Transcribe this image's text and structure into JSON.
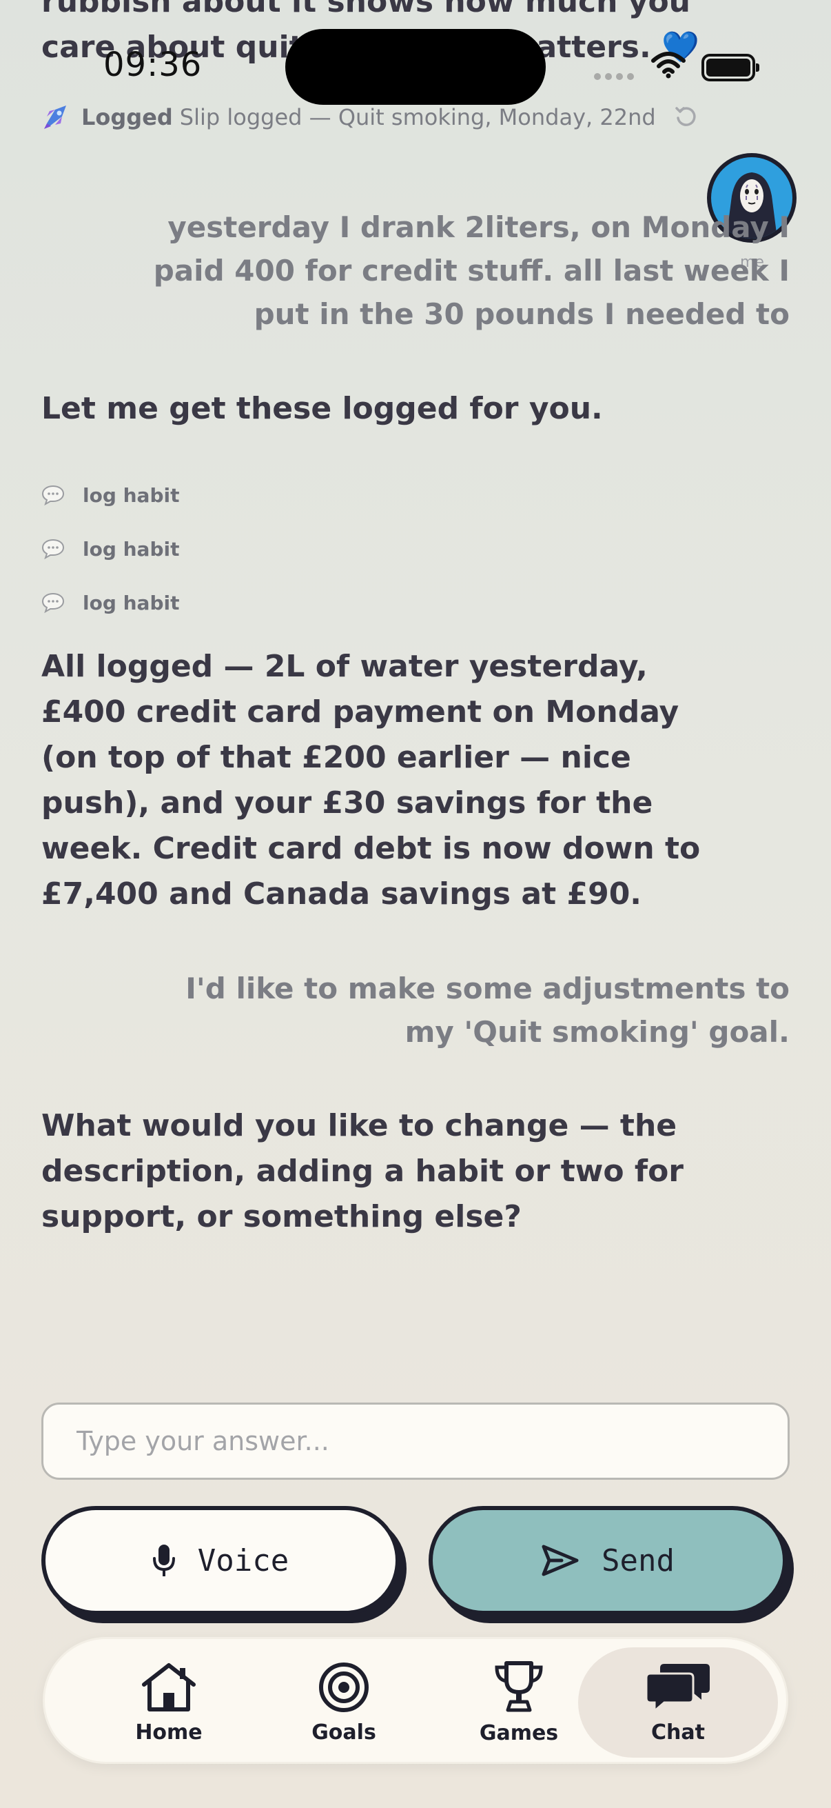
{
  "chat": {
    "scrolled_text": "rubbish about it shows how much you care about quitting — that matters. 💙",
    "log_line": {
      "logged_label": "Logged",
      "text": "Slip logged — Quit smoking, Monday, 22nd"
    },
    "avatar_label": "me",
    "messages": [
      {
        "role": "user",
        "text": "yesterday I drank 2liters, on Monday I paid 400 for credit stuff. all last week I put in the 30 pounds I needed to"
      },
      {
        "role": "assistant",
        "text": "Let me get these logged for you."
      },
      {
        "role": "assistant",
        "text": "All logged — 2L of water yesterday, £400 credit card payment on Monday (on top of that £200 earlier — nice push), and your £30 savings for the week. Credit card debt is now down to £7,400 and Canada savings at £90."
      },
      {
        "role": "user",
        "text": "I'd like to make some adjustments to my 'Quit smoking' goal."
      },
      {
        "role": "assistant",
        "text": "What would you like to change — the description, adding a habit or two for support, or something else?"
      }
    ],
    "tool_calls": [
      "log habit",
      "log habit",
      "log habit"
    ]
  },
  "status_bar": {
    "time": "09:36"
  },
  "input": {
    "placeholder": "Type your answer..."
  },
  "actions": {
    "voice_label": "Voice",
    "send_label": "Send"
  },
  "tabs": [
    {
      "label": "Home",
      "icon": "home-icon"
    },
    {
      "label": "Goals",
      "icon": "target-icon"
    },
    {
      "label": "Games",
      "icon": "trophy-icon"
    },
    {
      "label": "Chat",
      "icon": "chat-icon",
      "active": true
    }
  ],
  "colors": {
    "accent_send": "#8fbfbe",
    "text_dark": "#3a3845",
    "text_muted": "#7b7d84",
    "outline": "#1e1f2c"
  }
}
